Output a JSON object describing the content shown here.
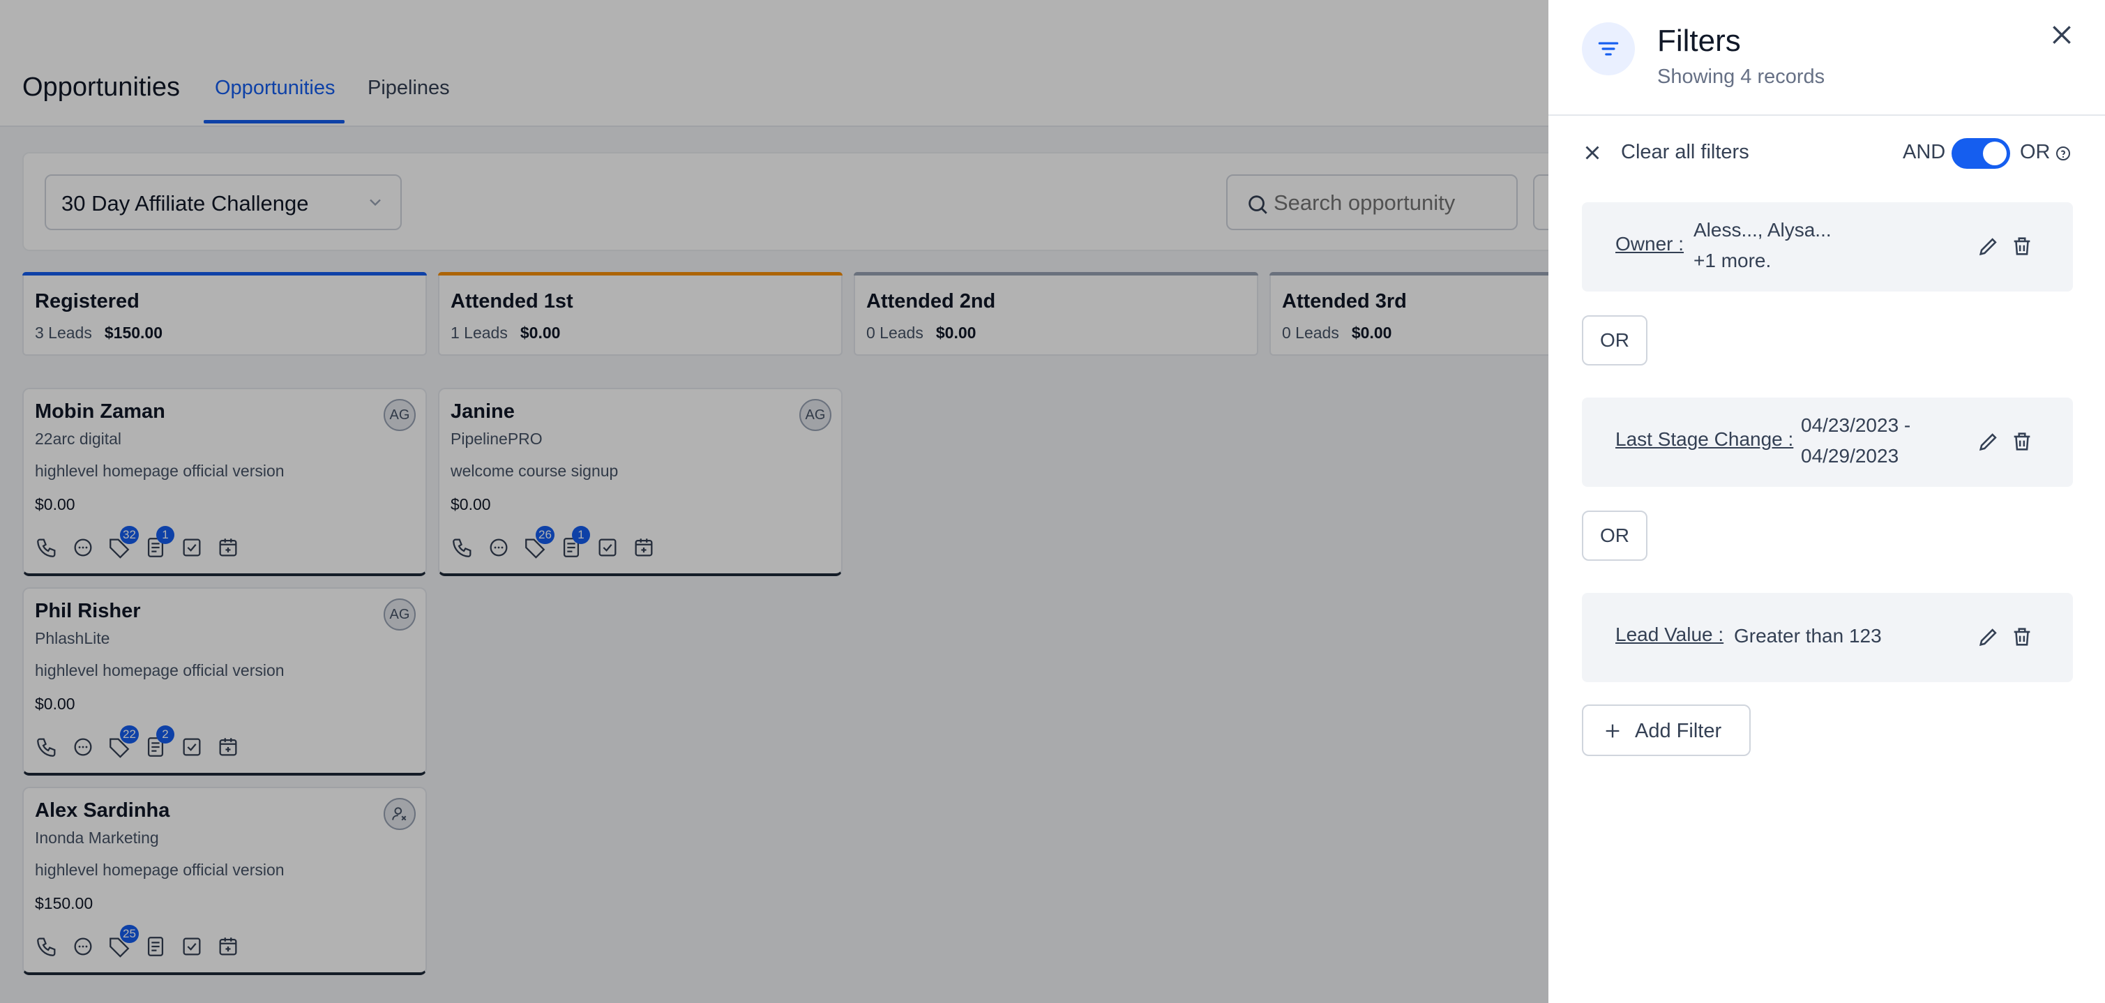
{
  "header": {
    "page_title": "Opportunities",
    "tabs": [
      {
        "label": "Opportunities",
        "active": true
      },
      {
        "label": "Pipelines",
        "active": false
      }
    ]
  },
  "toolbar": {
    "pipeline_selected": "30 Day Affiliate Challenge",
    "search_placeholder": "Search opportunity"
  },
  "stages": [
    {
      "name": "Registered",
      "leads": "3 Leads",
      "value": "$150.00",
      "color": "#155eef"
    },
    {
      "name": "Attended 1st",
      "leads": "1 Leads",
      "value": "$0.00",
      "color": "#f79009"
    },
    {
      "name": "Attended 2nd",
      "leads": "0 Leads",
      "value": "$0.00",
      "color": "#98a2b3"
    },
    {
      "name": "Attended 3rd",
      "leads": "0 Leads",
      "value": "$0.00",
      "color": "#98a2b3"
    }
  ],
  "cards": [
    {
      "name": "Mobin Zaman",
      "company": "22arc digital",
      "description": "highlevel homepage official version",
      "value": "$0.00",
      "avatar": "AG",
      "tags_count": "32",
      "notes_count": "1"
    },
    {
      "name": "Phil Risher",
      "company": "PhlashLite",
      "description": "highlevel homepage official version",
      "value": "$0.00",
      "avatar": "AG",
      "tags_count": "22",
      "notes_count": "2"
    },
    {
      "name": "Alex Sardinha",
      "company": "Inonda Marketing",
      "description": "highlevel homepage official version",
      "value": "$150.00",
      "avatar": "",
      "tags_count": "25",
      "notes_count": ""
    },
    {
      "name": "Janine",
      "company": "PipelinePRO",
      "description": "welcome course signup",
      "value": "$0.00",
      "avatar": "AG",
      "tags_count": "26",
      "notes_count": "1"
    }
  ],
  "filters_panel": {
    "title": "Filters",
    "subtitle": "Showing 4 records",
    "clear_label": "Clear all filters",
    "logic_and": "AND",
    "logic_or": "OR",
    "logic_selected": "OR",
    "filters": [
      {
        "key": "Owner :",
        "value_line1": "Aless..., Alysa...",
        "value_line2": "+1 more."
      },
      {
        "key": "Last Stage Change :",
        "value_line1": "04/23/2023 -",
        "value_line2": "04/29/2023"
      },
      {
        "key": "Lead Value :",
        "value_line1": "Greater than 123",
        "value_line2": ""
      }
    ],
    "connector_label": "OR",
    "add_filter_label": "Add Filter"
  },
  "colors": {
    "accent": "#155eef",
    "text": "#101828",
    "muted": "#667085"
  }
}
